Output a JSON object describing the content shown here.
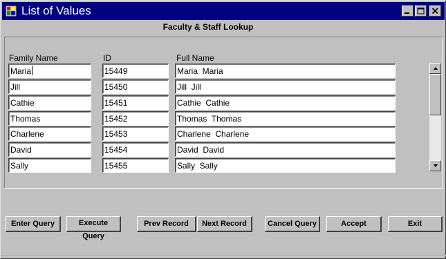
{
  "window": {
    "title": "List of Values",
    "panel_title": "Faculty & Staff Lookup"
  },
  "columns": {
    "family_name": "Family Name",
    "id": "ID",
    "full_name": "Full Name"
  },
  "rows": [
    {
      "family": "Maria",
      "id": "15449",
      "full": "Maria  Maria"
    },
    {
      "family": "Jill",
      "id": "15450",
      "full": "Jill  Jill"
    },
    {
      "family": "Cathie",
      "id": "15451",
      "full": "Cathie  Cathie"
    },
    {
      "family": "Thomas",
      "id": "15452",
      "full": "Thomas  Thomas"
    },
    {
      "family": "Charlene",
      "id": "15453",
      "full": "Charlene  Charlene"
    },
    {
      "family": "David",
      "id": "15454",
      "full": "David  David"
    },
    {
      "family": "Sally",
      "id": "15455",
      "full": "Sally  Sally"
    }
  ],
  "buttons": {
    "enter_query": "Enter Query",
    "execute_query": "Execute Query",
    "prev_record": "Prev Record",
    "next_record": "Next Record",
    "cancel_query": "Cancel Query",
    "accept": "Accept",
    "exit": "Exit"
  },
  "icons": {
    "app": "forms-app-icon",
    "minimize": "minimize-icon",
    "maximize": "maximize-icon",
    "close": "close-icon",
    "scroll_up": "arrow-up-icon",
    "scroll_down": "arrow-down-icon"
  },
  "colors": {
    "titlebar": "#000080",
    "face": "#c0c0c0"
  }
}
